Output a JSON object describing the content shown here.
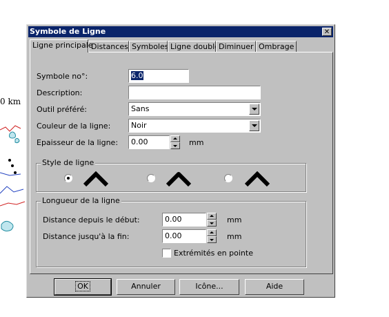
{
  "background": {
    "scale_text": "0 km"
  },
  "window": {
    "title": "Symbole de Ligne",
    "close_glyph": "✕"
  },
  "tabs": [
    {
      "label": "Ligne principale",
      "active": true
    },
    {
      "label": "Distances"
    },
    {
      "label": "Symboles"
    },
    {
      "label": "Ligne double"
    },
    {
      "label": "Diminuer"
    },
    {
      "label": "Ombrage"
    }
  ],
  "form": {
    "symbol_no": {
      "label": "Symbole no°:",
      "value": "6.0"
    },
    "description": {
      "label": "Description:",
      "value": ""
    },
    "tool": {
      "label": "Outil préféré:",
      "value": "Sans"
    },
    "color": {
      "label": "Couleur de la ligne:",
      "value": "Noir"
    },
    "thickness": {
      "label": "Epaisseur de la ligne:",
      "value": "0.00",
      "unit": "mm"
    }
  },
  "line_style": {
    "title": "Style de ligne",
    "options": [
      {
        "checked": true
      },
      {
        "checked": false
      },
      {
        "checked": false
      }
    ]
  },
  "line_length": {
    "title": "Longueur de la ligne",
    "start": {
      "label": "Distance depuis le début:",
      "value": "0.00",
      "unit": "mm"
    },
    "end": {
      "label": "Distance jusqu'à la fin:",
      "value": "0.00",
      "unit": "mm"
    },
    "pointed_ends": {
      "label": "Extrémités en pointe",
      "checked": false
    }
  },
  "buttons": {
    "ok": "OK",
    "cancel": "Annuler",
    "icon": "Icône...",
    "help": "Aide"
  }
}
